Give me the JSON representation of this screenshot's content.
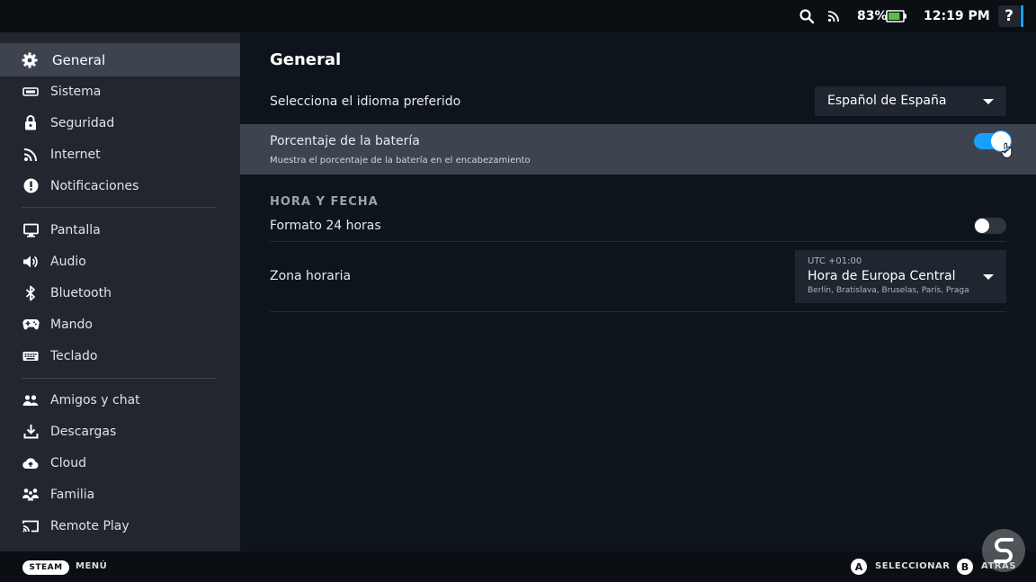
{
  "statusbar": {
    "battery_percent": "83%",
    "battery_level": 0.83,
    "time": "12:19 PM",
    "help_label": "?"
  },
  "sidebar": {
    "items": [
      {
        "label": "General",
        "icon": "gear-icon",
        "active": true
      },
      {
        "label": "Sistema",
        "icon": "system-icon"
      },
      {
        "label": "Seguridad",
        "icon": "lock-icon"
      },
      {
        "label": "Internet",
        "icon": "wifi-icon"
      },
      {
        "label": "Notificaciones",
        "icon": "alert-icon"
      },
      {
        "label": "Pantalla",
        "icon": "monitor-icon"
      },
      {
        "label": "Audio",
        "icon": "speaker-icon"
      },
      {
        "label": "Bluetooth",
        "icon": "bluetooth-icon"
      },
      {
        "label": "Mando",
        "icon": "gamepad-icon"
      },
      {
        "label": "Teclado",
        "icon": "keyboard-icon"
      },
      {
        "label": "Amigos y chat",
        "icon": "friends-icon"
      },
      {
        "label": "Descargas",
        "icon": "download-icon"
      },
      {
        "label": "Cloud",
        "icon": "cloud-icon"
      },
      {
        "label": "Familia",
        "icon": "family-icon"
      },
      {
        "label": "Remote Play",
        "icon": "cast-icon"
      }
    ]
  },
  "main": {
    "title": "General",
    "language": {
      "label": "Selecciona el idioma preferido",
      "value": "Español de España"
    },
    "battery_pct": {
      "label": "Porcentaje de la batería",
      "description": "Muestra el porcentaje de la batería en el encabezamiento",
      "enabled": true
    },
    "section_time": "HORA Y FECHA",
    "format24": {
      "label": "Formato 24 horas",
      "enabled": false
    },
    "timezone": {
      "label": "Zona horaria",
      "offset": "UTC +01:00",
      "value": "Hora de Europa Central",
      "cities": "Berlín, Bratislava, Bruselas, París, Praga"
    }
  },
  "bottombar": {
    "steam_label": "STEAM",
    "menu_label": "MENÚ",
    "a_button": "A",
    "select_label": "SELECCIONAR",
    "b_button": "B",
    "back_label": "ATRÁS"
  },
  "colors": {
    "accent": "#1a9fff",
    "sidebar_bg": "#23262e",
    "active_bg": "#3d4450",
    "main_bg": "#0e141b"
  }
}
